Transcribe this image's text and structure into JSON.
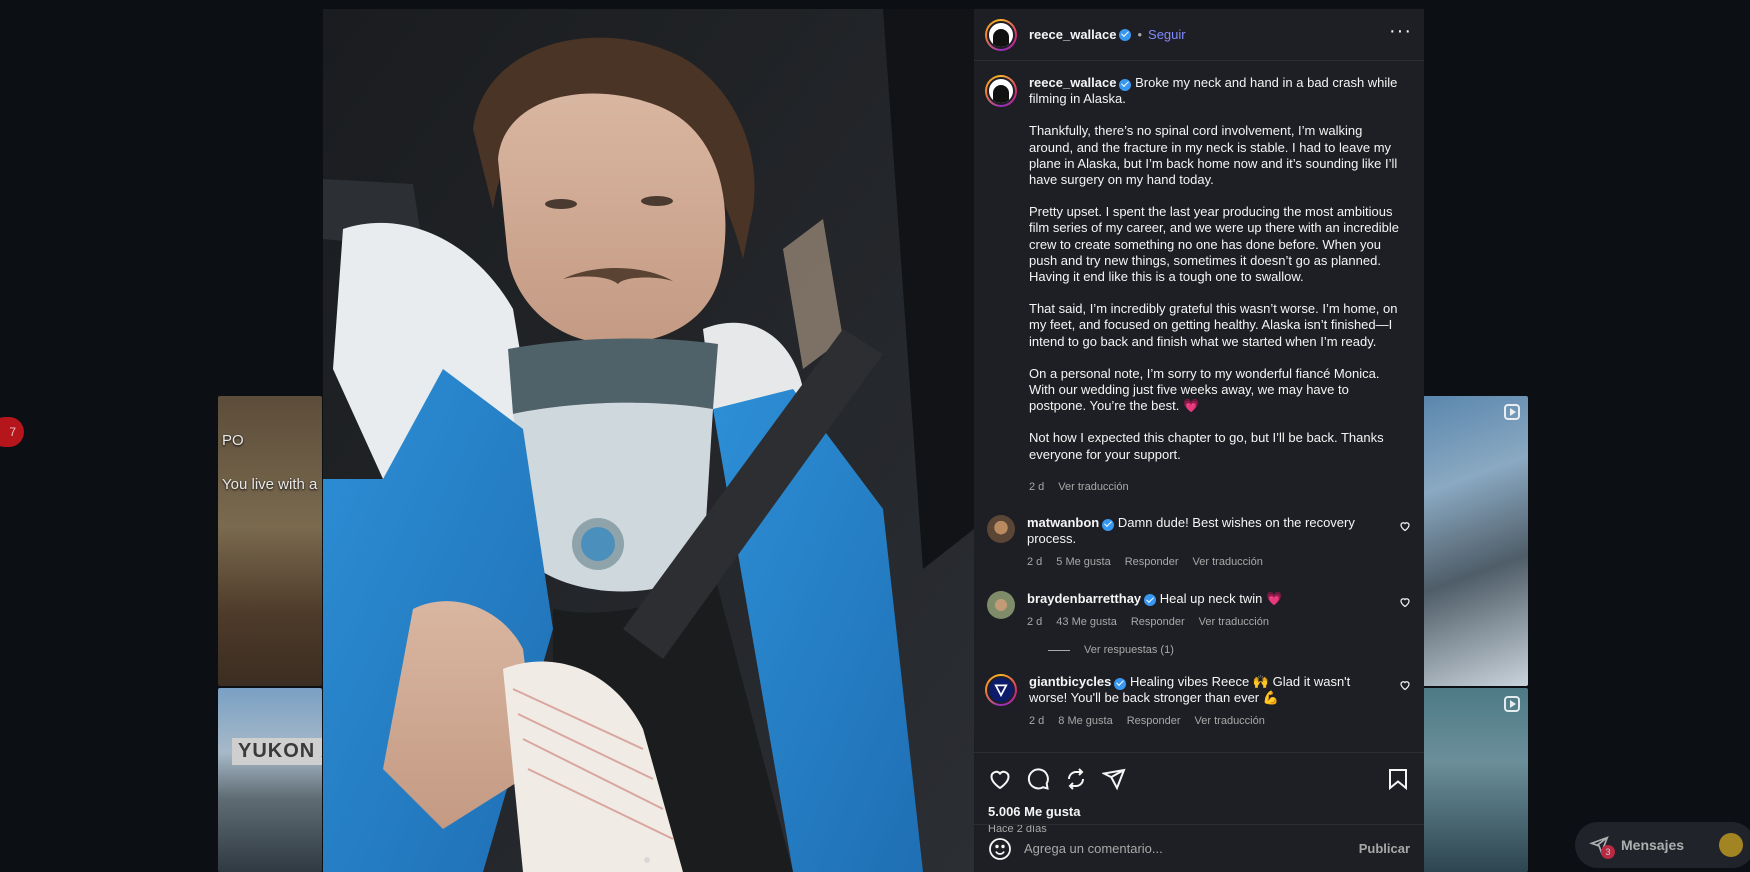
{
  "background": {
    "tile_left_text_1": "PO",
    "tile_left_text_2": "You live with a",
    "tile_left_sign": "YUKON A",
    "notification_count": "7",
    "messages_label": "Mensajes",
    "messages_badge": "3"
  },
  "post": {
    "author": "reece_wallace",
    "follow_label": "Seguir",
    "dot": "•",
    "more_icon": "more-options-icon",
    "caption": {
      "p1": "Broke my neck and hand in a bad crash while filming in Alaska.",
      "p2": "Thankfully, there’s no spinal cord involvement, I’m walking around, and the fracture in my neck is stable. I had to leave my plane in Alaska, but I’m back home now and it’s sounding like I’ll have surgery on my hand today.",
      "p3": "Pretty upset. I spent the last year producing the most ambitious film series of my career, and we were up there with an incredible crew to create something no one has done before. When you push and try new things, sometimes it doesn’t go as planned. Having it end like this is a tough one to swallow.",
      "p4": "That said, I’m incredibly grateful this wasn’t worse. I’m home, on my feet, and focused on getting healthy. Alaska isn’t finished—I intend to go back and finish what we started when I’m ready.",
      "p5": "On a personal note, I’m sorry to my wonderful fiancé Monica. With our wedding just five weeks away, we may have to postpone. You’re the best. 💗",
      "p6": "Not how I expected this chapter to go, but I’ll be back. Thanks everyone for your support.",
      "time": "2 d",
      "translate": "Ver traducción"
    },
    "comments": [
      {
        "user": "matwanbon",
        "text": "Damn dude! Best wishes on the recovery process.",
        "time": "2 d",
        "likes": "5 Me gusta",
        "reply": "Responder",
        "translate": "Ver traducción"
      },
      {
        "user": "braydenbarretthay",
        "text": "Heal up neck twin 💗",
        "time": "2 d",
        "likes": "43 Me gusta",
        "reply": "Responder",
        "translate": "Ver traducción",
        "view_replies": "Ver respuestas (1)"
      },
      {
        "user": "giantbicycles",
        "text": "Healing vibes Reece 🙌 Glad it wasn't worse! You'll be back stronger than ever 💪",
        "time": "2 d",
        "likes": "8 Me gusta",
        "reply": "Responder",
        "translate": "Ver traducción"
      }
    ],
    "like_count": "5.006 Me gusta",
    "posted_ago": "Hace 2 días",
    "comment_placeholder": "Agrega un comentario...",
    "publish_label": "Publicar"
  },
  "colors": {
    "accent_link": "#7f8bff",
    "verified": "#3897f0",
    "panel_bg": "#1e1f24",
    "page_bg": "#0c0f14"
  }
}
